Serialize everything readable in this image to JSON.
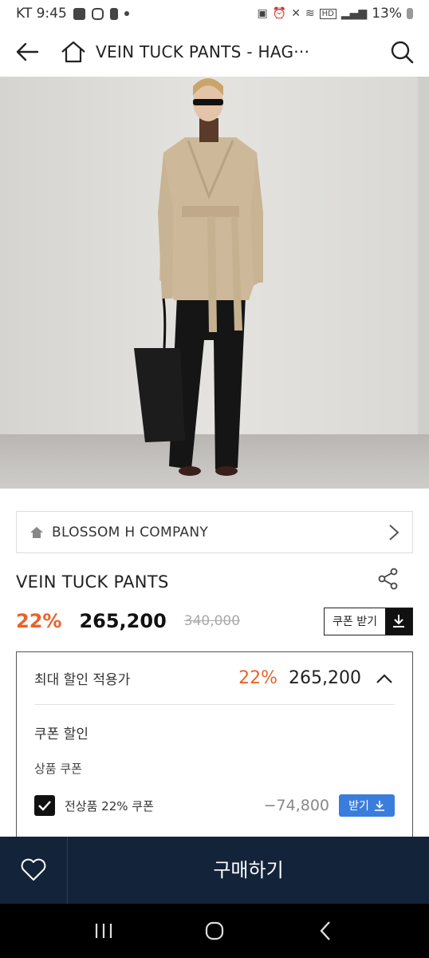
{
  "status_bar": {
    "carrier_time": "KT 9:45",
    "battery": "13%",
    "icons": [
      "gallery-icon",
      "instagram-icon",
      "notification-icon",
      "dot-icon",
      "lock-icon",
      "alarm-icon",
      "mute-icon",
      "wifi-icon",
      "hd-icon",
      "signal-icon",
      "battery-icon"
    ]
  },
  "header": {
    "title": "VEIN TUCK PANTS - HAG···",
    "icons": [
      "back-arrow-icon",
      "home-icon",
      "search-icon"
    ]
  },
  "product": {
    "brand": "BLOSSOM H COMPANY",
    "name": "VEIN TUCK PANTS",
    "discount_rate": "22%",
    "price": "265,200",
    "original_price": "340,000",
    "coupon_button": "쿠폰 받기"
  },
  "discount_panel": {
    "title": "최대 할인 적용가",
    "rate": "22%",
    "price": "265,200",
    "section": "쿠폰 할인",
    "subsection": "상품 쿠폰",
    "coupon_name": "전상품 22% 쿠폰",
    "coupon_amount": "−74,800",
    "coupon_checked": true,
    "get_button": "받기"
  },
  "buy_bar": {
    "buy_label": "구매하기"
  },
  "colors": {
    "accent_orange": "#e8632c",
    "buy_bar_navy": "#13233a",
    "coupon_blue": "#3b7ddd"
  }
}
